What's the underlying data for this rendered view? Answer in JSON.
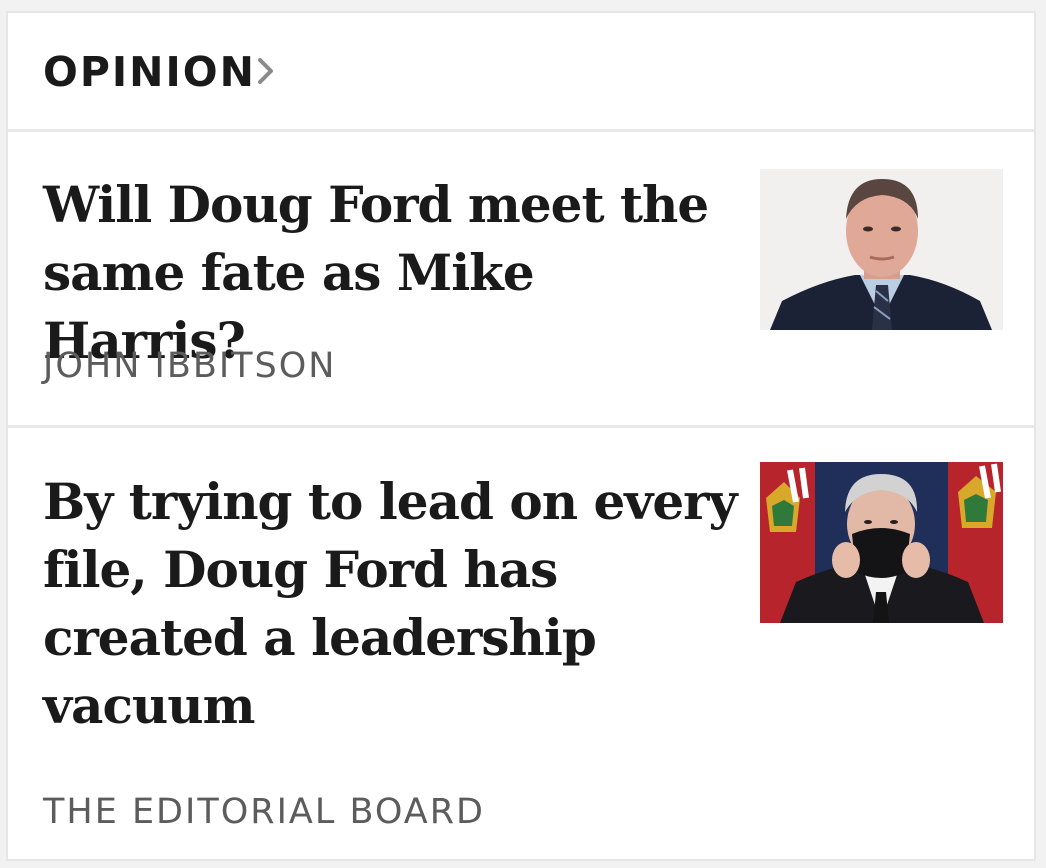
{
  "section": {
    "title": "OPINION",
    "chevron_icon": "chevron-right-icon"
  },
  "articles": [
    {
      "headline": "Will Doug Ford meet the same fate as Mike Harris?",
      "byline": "JOHN IBBITSON",
      "thumbnail_icon": "portrait-photo"
    },
    {
      "headline": "By trying to lead on every file, Doug Ford has created a leadership vacuum",
      "byline": "THE EDITORIAL BOARD",
      "thumbnail_icon": "press-conference-photo"
    }
  ],
  "colors": {
    "text": "#1a1a1a",
    "byline": "#5c5c5c",
    "divider": "#e8e8e8"
  }
}
